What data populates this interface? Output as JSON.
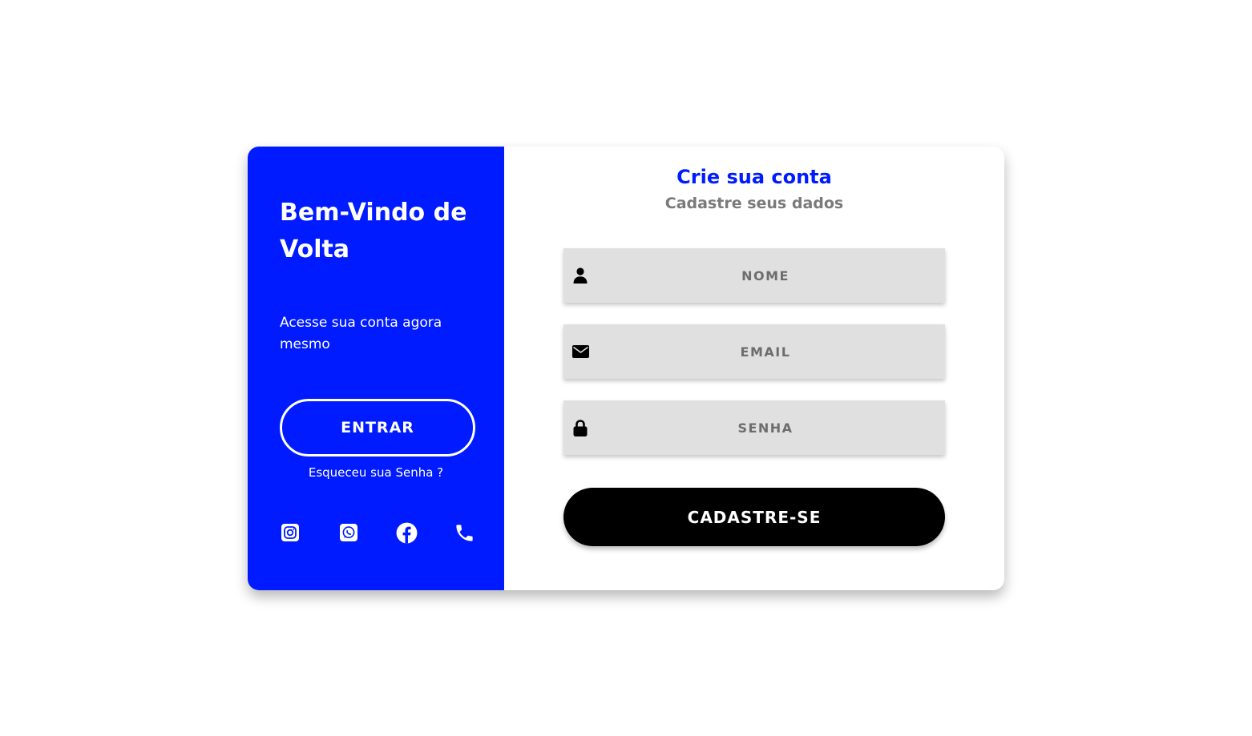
{
  "welcome": {
    "title": "Bem-Vindo de Volta",
    "subtitle": "Acesse sua conta agora mesmo",
    "enter_label": "ENTRAR",
    "forgot_label": "Esqueceu sua Senha ?"
  },
  "social_icons": [
    "instagram-icon",
    "whatsapp-icon",
    "facebook-icon",
    "phone-icon"
  ],
  "signup": {
    "heading": "Crie sua conta",
    "subheading": "Cadastre seus dados",
    "name_placeholder": "NOME",
    "email_placeholder": "EMAIL",
    "password_placeholder": "SENHA",
    "submit_label": "CADASTRE-SE"
  },
  "colors": {
    "primary": "#001bff",
    "field_bg": "#e0e0e0",
    "button": "#000000",
    "muted_text": "#7a7a7a"
  }
}
